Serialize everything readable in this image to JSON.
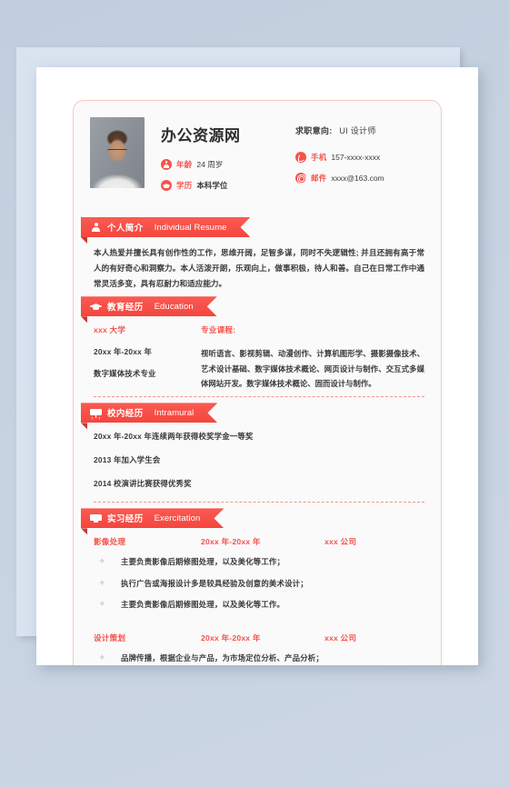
{
  "document": {
    "name": "办公资源网",
    "objective_label": "求职意向:",
    "objective_value": "UI 设计师",
    "photo_alt": "profile-photo"
  },
  "contacts": [
    {
      "icon": "person-icon",
      "label": "年龄",
      "value": "24 周岁",
      "bold": false
    },
    {
      "icon": "graduation-cap-icon",
      "label": "学历",
      "value": "本科学位",
      "bold": true
    },
    {
      "icon": "phone-icon",
      "label": "手机",
      "value": "157-xxxx-xxxx",
      "bold": false
    },
    {
      "icon": "mail-icon",
      "label": "邮件",
      "value": "xxxx@163.com",
      "bold": false
    }
  ],
  "sections": {
    "individual_resume": {
      "icon": "person-icon",
      "title_cn": "个人简介",
      "title_en": "Individual Resume",
      "paragraph": "本人热爱并擅长具有创作性的工作，思维开阔，足智多谋，同时不失逻辑性; 并且还拥有高于常人的有好奇心和洞察力。本人活泼开朗，乐观向上，做事积极，待人和善。自己在日常工作中通常灵活多变，具有忍耐力和适应能力。"
    },
    "education": {
      "icon": "graduation-cap-icon",
      "title_cn": "教育经历",
      "title_en": "Education",
      "school": "xxx 大学",
      "period": "20xx 年-20xx 年",
      "major": "数字媒体技术专业",
      "courses_label": "专业课程:",
      "courses": "视听语言、影视剪辑、动漫创作、计算机图形学、摄影摄像技术、艺术设计基础、数字媒体技术概论、网页设计与制作、交互式多媒体网站开发。数字媒体技术概论、固而设计与制作。"
    },
    "intramural": {
      "icon": "board-icon",
      "title_cn": "校内经历",
      "title_en": "Intramural",
      "items": [
        "20xx 年-20xx 年连续两年获得校奖学金一等奖",
        "2013 年加入学生会",
        "2014 校演讲比赛获得优秀奖"
      ]
    },
    "exercitation": {
      "icon": "monitor-icon",
      "title_cn": "实习经历",
      "title_en": "Exercitation",
      "jobs": [
        {
          "role": "影像处理",
          "period": "20xx 年-20xx 年",
          "org": "xxx 公司",
          "bullets": [
            "主要负责影像后期修图处理，以及美化等工作；",
            "执行广告或海报设计多是较具经验及创意的美术设计；",
            "主要负责影像后期修图处理，以及美化等工作。"
          ]
        },
        {
          "role": "设计策划",
          "period": "20xx 年-20xx 年",
          "org": "xxx 公司",
          "bullets": [
            "品牌传播，根据企业与产品，为市场定位分析、产品分析；"
          ]
        }
      ]
    }
  },
  "theme": {
    "accent": "#f4534d",
    "ribbon_dark": "#c93a33",
    "card_bg": "#fafafa",
    "card_border": "#f6c7c5",
    "page_bg": "#ffffff",
    "back_page_bg": "#d9e3f0",
    "canvas_bg": "#c6d2e0",
    "text": "#3a3a3a"
  },
  "glyphs": {
    "bullet_diamond": "✧"
  }
}
